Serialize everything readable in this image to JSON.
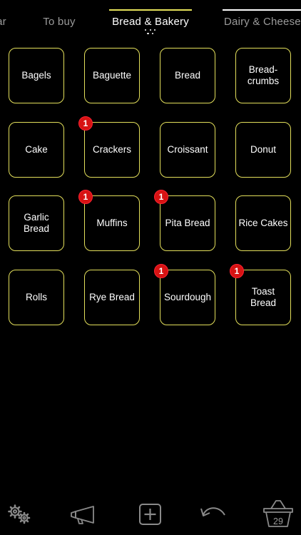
{
  "tabs": [
    {
      "label": "ar",
      "active": false
    },
    {
      "label": "To buy",
      "active": false
    },
    {
      "label": "Bread & Bakery",
      "active": true
    },
    {
      "label": "Dairy & Cheese",
      "active": false
    }
  ],
  "accent_color": "#e3df5b",
  "badge_color": "#d71313",
  "items": [
    {
      "label": "Bagels",
      "badge": ""
    },
    {
      "label": "Baguette",
      "badge": ""
    },
    {
      "label": "Bread",
      "badge": ""
    },
    {
      "label": "Bread-\ncrumbs",
      "badge": ""
    },
    {
      "label": "Cake",
      "badge": ""
    },
    {
      "label": "Crackers",
      "badge": "1"
    },
    {
      "label": "Croissant",
      "badge": ""
    },
    {
      "label": "Donut",
      "badge": ""
    },
    {
      "label": "Garlic Bread",
      "badge": ""
    },
    {
      "label": "Muffins",
      "badge": "1"
    },
    {
      "label": "Pita Bread",
      "badge": "1"
    },
    {
      "label": "Rice Cakes",
      "badge": ""
    },
    {
      "label": "Rolls",
      "badge": ""
    },
    {
      "label": "Rye Bread",
      "badge": ""
    },
    {
      "label": "Sourdough",
      "badge": "1"
    },
    {
      "label": "Toast Bread",
      "badge": "1"
    }
  ],
  "toolbar": {
    "settings_icon": "gears-icon",
    "announce_icon": "megaphone-icon",
    "add_icon": "plus-square-icon",
    "undo_icon": "undo-icon",
    "basket_icon": "basket-icon",
    "basket_count": "29"
  }
}
